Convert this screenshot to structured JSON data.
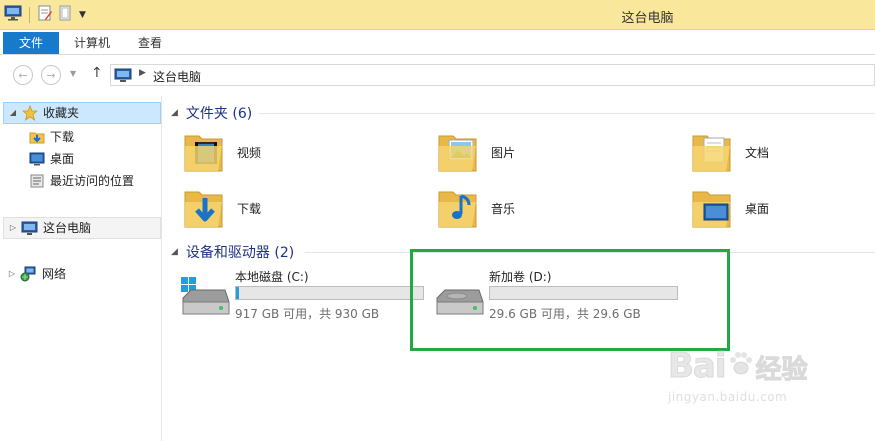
{
  "window": {
    "title": "这台电脑"
  },
  "ribbon": {
    "tabs": [
      {
        "label": "文件",
        "active": true
      },
      {
        "label": "计算机"
      },
      {
        "label": "查看"
      }
    ]
  },
  "address": {
    "crumbs": [
      "这台电脑"
    ]
  },
  "navigation": {
    "favorites": {
      "label": "收藏夹",
      "items": [
        {
          "label": "下载",
          "icon": "download-folder-icon"
        },
        {
          "label": "桌面",
          "icon": "desktop-icon"
        },
        {
          "label": "最近访问的位置",
          "icon": "recent-places-icon"
        }
      ]
    },
    "this_pc": {
      "label": "这台电脑"
    },
    "network": {
      "label": "网络"
    }
  },
  "folders_group": {
    "title": "文件夹 (6)",
    "items": [
      {
        "label": "视频",
        "icon": "videos-folder-icon"
      },
      {
        "label": "图片",
        "icon": "pictures-folder-icon"
      },
      {
        "label": "文档",
        "icon": "documents-folder-icon"
      },
      {
        "label": "下载",
        "icon": "downloads-folder-icon"
      },
      {
        "label": "音乐",
        "icon": "music-folder-icon"
      },
      {
        "label": "桌面",
        "icon": "desktop-folder-icon"
      }
    ]
  },
  "drives_group": {
    "title": "设备和驱动器 (2)",
    "items": [
      {
        "name": "本地磁盘 (C:)",
        "capacity": "917 GB 可用，共 930 GB",
        "used_fraction": 0.014,
        "icon": "system-drive-icon"
      },
      {
        "name": "新加卷 (D:)",
        "capacity": "29.6 GB 可用，共 29.6 GB",
        "used_fraction": 0.0,
        "icon": "drive-icon"
      }
    ]
  },
  "watermark": {
    "brand": "Bai",
    "brand_cn": "经验",
    "url": "jingyan.baidu.com"
  },
  "colors": {
    "accent": "#1979ca",
    "titlebar": "#f9e89b",
    "highlight": "#22a844",
    "group_title": "#1e3287"
  }
}
